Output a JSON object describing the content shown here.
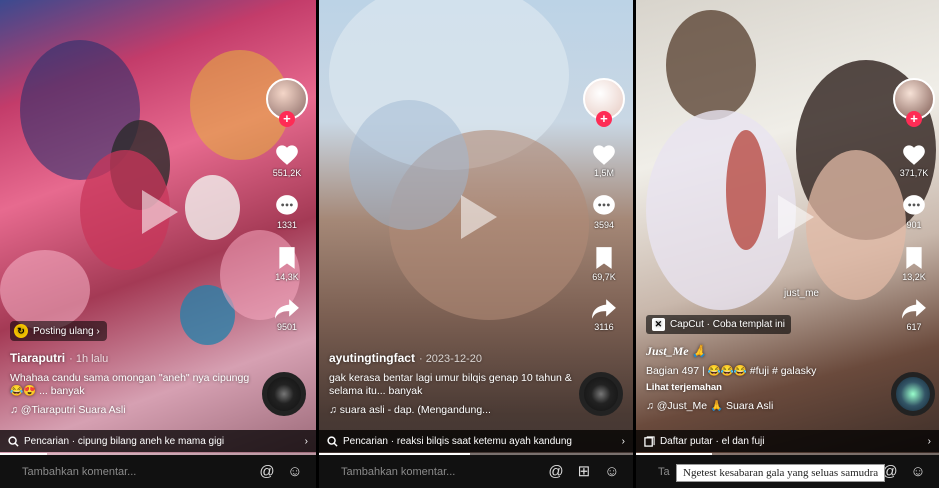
{
  "panels": [
    {
      "like_count": "551,2K",
      "comment_count": "1331",
      "bookmark_count": "14,3K",
      "share_count": "9501",
      "badge": "Posting ulang ›",
      "username": "Tiaraputri",
      "time": "· 1h lalu",
      "caption": "Whahaa candu sama omongan \"aneh\" nya cipungg 😂😍 ... banyak",
      "sound": "♫ @Tiaraputri Suara Asli",
      "search": "Pencarian · cipung bilang aneh ke mama gigi",
      "progress": 0.15,
      "comment_placeholder": "Tambahkan komentar..."
    },
    {
      "like_count": "1,5M",
      "comment_count": "3594",
      "bookmark_count": "69,7K",
      "share_count": "3116",
      "username": "ayutingtingfact",
      "time": "· 2023-12-20",
      "caption": "gak kerasa bentar lagi umur bilqis genap 10 tahun & selama itu... banyak",
      "sound": "♫ suara asli - dap. (Mengandung...",
      "search": "Pencarian · reaksi bilqis saat ketemu ayah kandung",
      "progress": 0.48,
      "comment_placeholder": "Tambahkan komentar..."
    },
    {
      "like_count": "371,7K",
      "comment_count": "901",
      "bookmark_count": "13,2K",
      "share_count": "617",
      "sticker_label": "just_me",
      "capcut": "CapCut · Coba templat ini",
      "username": "Just_Me 🙏",
      "caption": "Bagian 497 | 😂😂😂 #fuji # galasky",
      "translate": "Lihat terjemahan",
      "sound": "♫ @Just_Me 🙏 Suara Asli",
      "search": "Daftar putar · el dan fuji",
      "progress": 0.25,
      "comment_placeholder": "Ta",
      "tooltip": "Ngetest kesabaran gala yang seluas samudra"
    }
  ],
  "icons": [
    "heart-icon",
    "comment-icon",
    "bookmark-icon",
    "share-icon",
    "search-icon",
    "at-icon",
    "gift-icon",
    "emoji-icon",
    "music-note-icon",
    "play-icon"
  ],
  "colors": {
    "accent": "#fe2c55",
    "badge": "#f5c400"
  }
}
